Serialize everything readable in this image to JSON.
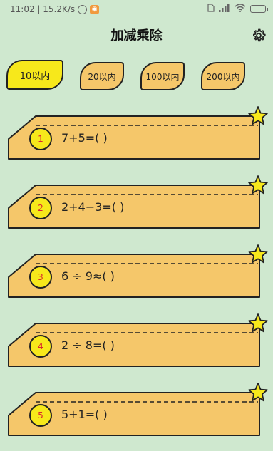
{
  "status_bar": {
    "time_speed": "11:02 | 15.2K/s",
    "app_icon_glyph": "◉",
    "icons": [
      "alarm-icon",
      "app-icon",
      "sim-icon",
      "signal-icon",
      "wifi-icon",
      "battery-icon"
    ]
  },
  "header": {
    "title": "加减乘除",
    "settings_icon": "gear-icon"
  },
  "tabs": [
    {
      "label": "10以内",
      "active": true
    },
    {
      "label": "20以内",
      "active": false
    },
    {
      "label": "100以内",
      "active": false
    },
    {
      "label": "200以内",
      "active": false
    }
  ],
  "questions": [
    {
      "number": "1",
      "expression": "7+5=( )"
    },
    {
      "number": "2",
      "expression": "2+4−3=( )"
    },
    {
      "number": "3",
      "expression": "6 ÷ 9≈( )"
    },
    {
      "number": "4",
      "expression": "2 ÷ 8=( )"
    },
    {
      "number": "5",
      "expression": "5+1=( )"
    }
  ],
  "colors": {
    "background": "#cfe8cf",
    "card": "#f5c76a",
    "active_tab": "#f7e81b",
    "star": "#f7e81b",
    "number_text": "#d9272e"
  }
}
